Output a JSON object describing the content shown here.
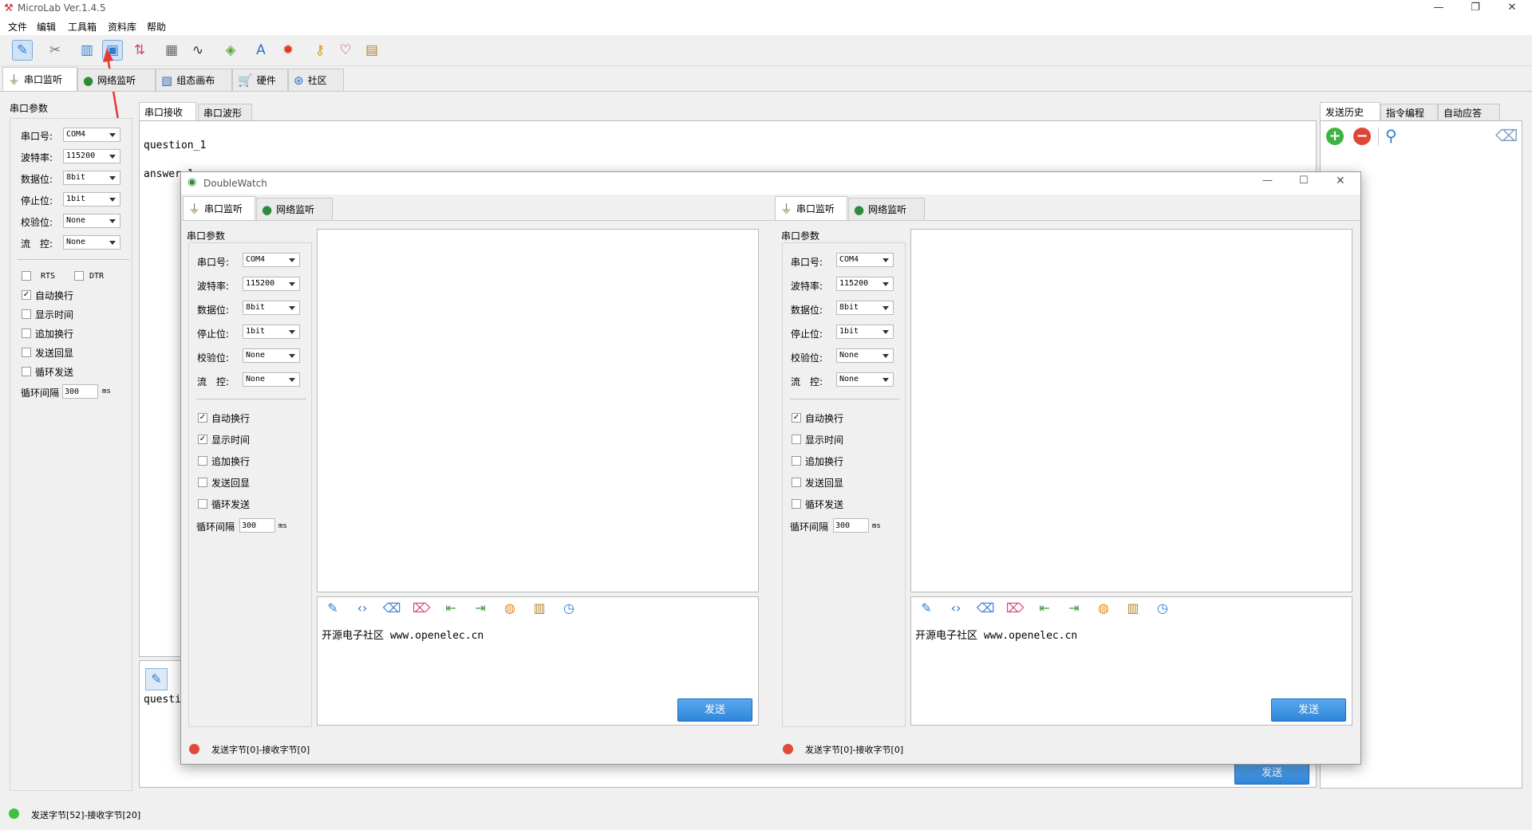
{
  "app": {
    "title": "MicroLab Ver.1.4.5"
  },
  "window_controls": {
    "minimize": "—",
    "restore": "❐",
    "close": "✕"
  },
  "menu": [
    "文件",
    "编辑",
    "工具箱",
    "资料库",
    "帮助"
  ],
  "toolbar_icons": [
    "serial-connect-icon",
    "tools-icon",
    "split-view-icon",
    "double-watch-icon",
    "data-transfer-icon",
    "calculator-icon",
    "waveform-icon",
    "package-icon",
    "font-icon",
    "flame-icon",
    "key-icon",
    "heart-icon",
    "book-icon"
  ],
  "main_tabs": [
    {
      "label": "串口监听",
      "icon": "serial-plug-icon"
    },
    {
      "label": "网络监听",
      "icon": "globe-icon"
    },
    {
      "label": "组态画布",
      "icon": "canvas-icon"
    },
    {
      "label": "硬件",
      "icon": "cart-icon"
    },
    {
      "label": "社区",
      "icon": "community-icon"
    }
  ],
  "serial_params": {
    "title": "串口参数",
    "port_label": "串口号:",
    "port": "COM4",
    "baud_label": "波特率:",
    "baud": "115200",
    "data_label": "数据位:",
    "data": "8bit",
    "stop_label": "停止位:",
    "stop": "1bit",
    "parity_label": "校验位:",
    "parity": "None",
    "flow_label": "流　控:",
    "flow": "None",
    "rts": "RTS",
    "dtr": "DTR",
    "auto_newline": "自动换行",
    "show_time": "显示时间",
    "append_newline": "追加换行",
    "echo": "发送回显",
    "loop_send": "循环发送",
    "loop_interval_label": "循环间隔",
    "loop_interval": "300",
    "ms": "ms"
  },
  "receive_tabs": [
    "串口接收",
    "串口波形"
  ],
  "receive_text": {
    "line1": "question_1",
    "line2": "answer_1"
  },
  "send_area": {
    "text": "questi",
    "send_button": "发送"
  },
  "right_tabs": [
    "发送历史",
    "指令编程",
    "自动应答"
  ],
  "status": {
    "text": "发送字节[52]-接收字节[20]",
    "color": "#3fbf3f"
  },
  "dialog": {
    "title": "DoubleWatch",
    "controls": {
      "minimize": "—",
      "maximize": "☐",
      "close": "✕"
    },
    "tabs": [
      "串口监听",
      "网络监听"
    ],
    "left": {
      "params_title": "串口参数",
      "port_label": "串口号:",
      "port": "COM4",
      "baud_label": "波特率:",
      "baud": "115200",
      "data_label": "数据位:",
      "data": "8bit",
      "stop_label": "停止位:",
      "stop": "1bit",
      "parity_label": "校验位:",
      "parity": "None",
      "flow_label": "流　控:",
      "flow": "None",
      "auto_newline": "自动换行",
      "show_time": "显示时间",
      "append_newline": "追加换行",
      "echo": "发送回显",
      "loop_send": "循环发送",
      "loop_interval_label": "循环间隔",
      "loop_interval": "300",
      "ms": "ms",
      "send_text": "开源电子社区 www.openelec.cn",
      "send_button": "发送",
      "status": "发送字节[0]-接收字节[0]",
      "status_color": "#e04a3a"
    },
    "right": {
      "params_title": "串口参数",
      "port_label": "串口号:",
      "port": "COM4",
      "baud_label": "波特率:",
      "baud": "115200",
      "data_label": "数据位:",
      "data": "8bit",
      "stop_label": "停止位:",
      "stop": "1bit",
      "parity_label": "校验位:",
      "parity": "None",
      "flow_label": "流　控:",
      "flow": "None",
      "auto_newline": "自动换行",
      "show_time": "显示时间",
      "append_newline": "追加换行",
      "echo": "发送回显",
      "loop_send": "循环发送",
      "loop_interval_label": "循环间隔",
      "loop_interval": "300",
      "ms": "ms",
      "send_text": "开源电子社区 www.openelec.cn",
      "send_button": "发送",
      "status": "发送字节[0]-接收字节[0]",
      "status_color": "#e04a3a"
    }
  },
  "checkmark": "✓"
}
